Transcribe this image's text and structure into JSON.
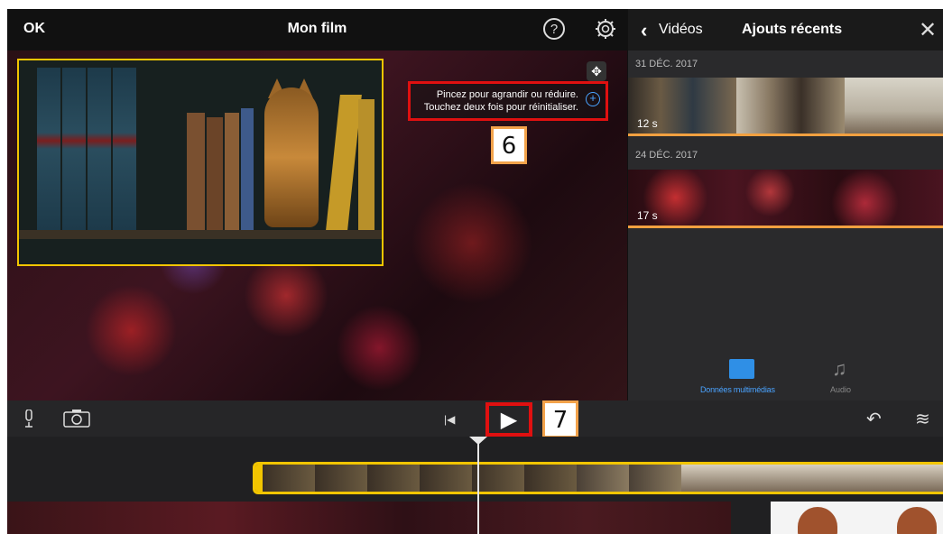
{
  "topbar": {
    "ok_label": "OK",
    "title": "Mon film",
    "help_symbol": "?"
  },
  "viewer": {
    "tooltip": {
      "line1": "Pincez pour agrandir ou réduire.",
      "line2": "Touchez deux fois pour réinitialiser."
    },
    "step_badge_6": "6"
  },
  "panel": {
    "back_label": "Vidéos",
    "title": "Ajouts récents",
    "sections": [
      {
        "date": "31 DÉC. 2017",
        "duration": "12 s"
      },
      {
        "date": "24 DÉC. 2017",
        "duration": "17 s"
      }
    ],
    "tabs": {
      "media_label": "Données multimédias",
      "audio_label": "Audio"
    }
  },
  "controls": {
    "play_symbol": "▶",
    "step_badge_7": "7"
  },
  "colors": {
    "accent_yellow": "#f2c500",
    "highlight_red": "#e01010",
    "badge_orange": "#f2a24a",
    "ios_blue": "#4aa3ff",
    "clip_bar_orange": "#f2a040"
  },
  "icons": [
    "help-icon",
    "gear-icon",
    "move-icon",
    "zoom-icon",
    "chevron-left-icon",
    "close-icon",
    "media-icon",
    "music-note-icon",
    "microphone-icon",
    "camera-icon",
    "skip-back-icon",
    "play-icon",
    "undo-icon",
    "waveform-icon"
  ]
}
